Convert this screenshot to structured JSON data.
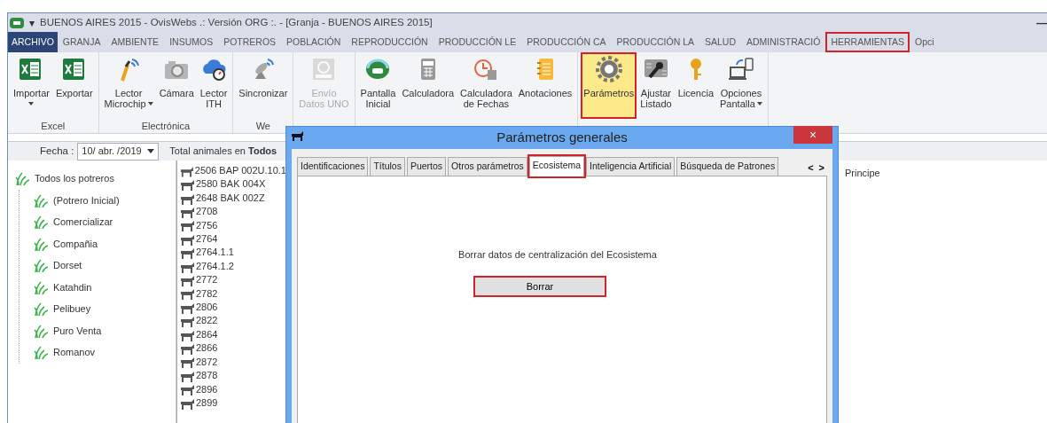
{
  "window": {
    "title": "BUENOS AIRES  2015 - OvisWebs  .: Versión ORG :. - [Granja - BUENOS AIRES  2015]",
    "quick_access": "▾",
    "minimize": "—"
  },
  "menu": [
    {
      "label": "ARCHIVO",
      "selected": true,
      "highlighted": false
    },
    {
      "label": "GRANJA",
      "selected": false,
      "highlighted": false
    },
    {
      "label": "AMBIENTE",
      "selected": false,
      "highlighted": false
    },
    {
      "label": "INSUMOS",
      "selected": false,
      "highlighted": false
    },
    {
      "label": "POTREROS",
      "selected": false,
      "highlighted": false
    },
    {
      "label": "POBLACIÓN",
      "selected": false,
      "highlighted": false
    },
    {
      "label": "REPRODUCCIÓN",
      "selected": false,
      "highlighted": false
    },
    {
      "label": "PRODUCCIÓN LE",
      "selected": false,
      "highlighted": false
    },
    {
      "label": "PRODUCCIÓN CA",
      "selected": false,
      "highlighted": false
    },
    {
      "label": "PRODUCCIÓN LA",
      "selected": false,
      "highlighted": false
    },
    {
      "label": "SALUD",
      "selected": false,
      "highlighted": false
    },
    {
      "label": "ADMINISTRACIÓ",
      "selected": false,
      "highlighted": false
    },
    {
      "label": "HERRAMIENTAS",
      "selected": false,
      "highlighted": true
    },
    {
      "label": "Opci",
      "selected": false,
      "highlighted": false
    }
  ],
  "ribbon": [
    {
      "label": "Excel",
      "buttons": [
        {
          "label": "Importar",
          "dropdown": true,
          "disabled": false,
          "highlighted": false
        },
        {
          "label": "Exportar",
          "dropdown": false,
          "disabled": false,
          "highlighted": false
        }
      ]
    },
    {
      "label": "Electrónica",
      "buttons": [
        {
          "label": "Lector Microchip",
          "dropdown": true,
          "disabled": false,
          "highlighted": false
        },
        {
          "label": "Cámara",
          "dropdown": false,
          "disabled": false,
          "highlighted": false
        },
        {
          "label": "Lector ITH",
          "dropdown": false,
          "disabled": false,
          "highlighted": false
        }
      ]
    },
    {
      "label": "We",
      "buttons": [
        {
          "label": "Sincronizar",
          "dropdown": false,
          "disabled": false,
          "highlighted": false
        }
      ]
    },
    {
      "buttons": [
        {
          "label": "Envío Datos UNO",
          "dropdown": false,
          "disabled": true,
          "highlighted": false
        }
      ]
    },
    {
      "buttons": [
        {
          "label": "Pantalla Inicial",
          "dropdown": false,
          "disabled": false,
          "highlighted": false
        },
        {
          "label": "Calculadora",
          "dropdown": false,
          "disabled": false,
          "highlighted": false
        },
        {
          "label": "Calculadora de Fechas",
          "dropdown": false,
          "disabled": false,
          "highlighted": false
        },
        {
          "label": "Anotaciones",
          "dropdown": false,
          "disabled": false,
          "highlighted": false
        }
      ]
    },
    {
      "buttons": [
        {
          "label": "Parámetros",
          "dropdown": false,
          "disabled": false,
          "highlighted": true
        },
        {
          "label": "Ajustar Listado",
          "dropdown": false,
          "disabled": false,
          "highlighted": false
        },
        {
          "label": "Licencia",
          "dropdown": false,
          "disabled": false,
          "highlighted": false
        },
        {
          "label": "Opciones Pantalla",
          "dropdown": true,
          "disabled": false,
          "highlighted": false
        }
      ]
    }
  ],
  "filter_bar": {
    "date_label": "Fecha :",
    "date_value": "10/ abr. /2019",
    "total": "Total animales en **Todos**"
  },
  "tree": {
    "label": "Todos los potreros",
    "children": [
      {
        "label": "(Potrero Inicial)"
      },
      {
        "label": "Comercializar"
      },
      {
        "label": "Compañia"
      },
      {
        "label": "Dorset"
      },
      {
        "label": "Katahdin"
      },
      {
        "label": "Pelibuey"
      },
      {
        "label": "Puro Venta"
      },
      {
        "label": "Romanov"
      }
    ]
  },
  "animals": [
    "2506 BAP 002U.10.1",
    "2580 BAK 004X",
    "2648 BAK 002Z",
    "2708",
    "2756",
    "2764",
    "2764.1.1",
    "2764.1.2",
    "2772",
    "2782",
    "2806",
    "2822",
    "2864",
    "2866",
    "2872",
    "2878",
    "2896",
    "2899"
  ],
  "right_panel": {
    "text": "Principe"
  },
  "dialog": {
    "title": "Parámetros generales",
    "close": "×",
    "tabs": [
      {
        "label": "Identificaciones",
        "selected": false,
        "highlighted": false
      },
      {
        "label": "Títulos",
        "selected": false,
        "highlighted": false
      },
      {
        "label": "Puertos",
        "selected": false,
        "highlighted": false
      },
      {
        "label": "Otros parámetros",
        "selected": false,
        "highlighted": false
      },
      {
        "label": "Ecosistema",
        "selected": true,
        "highlighted": true
      },
      {
        "label": "Inteligencia Artificial",
        "selected": false,
        "highlighted": false
      },
      {
        "label": "Búsqueda de Patrones",
        "selected": false,
        "highlighted": false
      }
    ],
    "scroll_left": "<",
    "scroll_right": ">",
    "message": "Borrar datos de centralización del Ecosistema",
    "button": {
      "label": "Borrar",
      "highlighted": true
    }
  }
}
